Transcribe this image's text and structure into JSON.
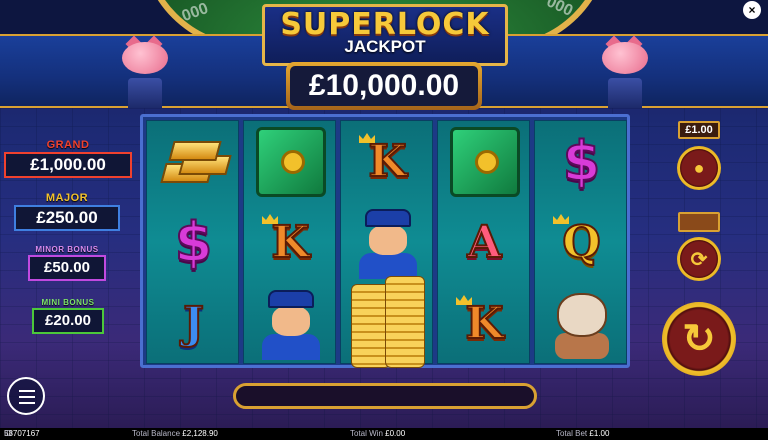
{
  "game": {
    "title_word": "SUPERLOCK",
    "title_sub": "JACKPOT",
    "jackpot_amount": "£10,000.00"
  },
  "top_wheel_bills": [
    "000",
    "$",
    "000"
  ],
  "tiers": [
    {
      "name": "GRAND",
      "amount": "£1,000.00",
      "color": "#f0412e"
    },
    {
      "name": "MAJOR",
      "amount": "£250.00",
      "color": "#3f7fe0"
    },
    {
      "name": "MINOR BONUS",
      "amount": "£50.00",
      "color": "#c14ae0"
    },
    {
      "name": "MINI BONUS",
      "amount": "£20.00",
      "color": "#4cc83a"
    }
  ],
  "reels": [
    [
      "gold-bars",
      "dollar",
      "J"
    ],
    [
      "safe",
      "K",
      "policeman"
    ],
    [
      "K",
      "policeman",
      "gold-coins"
    ],
    [
      "safe",
      "A",
      "K"
    ],
    [
      "dollar",
      "Q",
      "bulldog"
    ]
  ],
  "symbol_text": {
    "dollar": "$",
    "J": "J",
    "K": "K",
    "A": "A",
    "Q": "Q"
  },
  "controls": {
    "bet_value": "£1.00",
    "coin_icon": "coin-stack-icon",
    "autoplay_icon": "autoplay-icon",
    "spin_icon": "spin-arrow-icon",
    "menu_icon": "hamburger-menu-icon",
    "close": "×",
    "win_message": ""
  },
  "status_bar": {
    "id_label": "ID",
    "id_value": "58707167",
    "balance_label": "Total Balance",
    "balance_value": "£2,128.90",
    "win_label": "Total Win",
    "win_value": "£0.00",
    "bet_label": "Total Bet",
    "bet_value": "£1.00"
  }
}
